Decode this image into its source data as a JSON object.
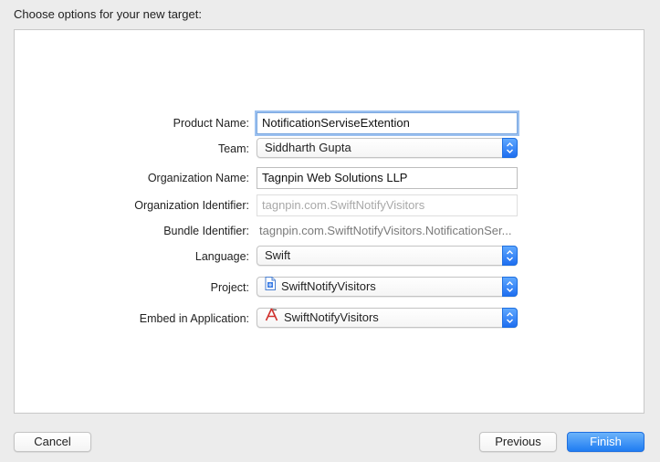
{
  "heading": "Choose options for your new target:",
  "form": {
    "product_name": {
      "label": "Product Name:",
      "value": "NotificationServiseExtention"
    },
    "team": {
      "label": "Team:",
      "value": "Siddharth Gupta"
    },
    "organization_name": {
      "label": "Organization Name:",
      "value": "Tagnpin Web Solutions LLP"
    },
    "organization_identifier": {
      "label": "Organization Identifier:",
      "value": "tagnpin.com.SwiftNotifyVisitors"
    },
    "bundle_identifier": {
      "label": "Bundle Identifier:",
      "value": "tagnpin.com.SwiftNotifyVisitors.NotificationSer..."
    },
    "language": {
      "label": "Language:",
      "value": "Swift"
    },
    "project": {
      "label": "Project:",
      "value": "SwiftNotifyVisitors",
      "icon": "project-file-icon"
    },
    "embed_in_application": {
      "label": "Embed in Application:",
      "value": "SwiftNotifyVisitors",
      "icon": "app-target-icon"
    }
  },
  "buttons": {
    "cancel": "Cancel",
    "previous": "Previous",
    "finish": "Finish"
  },
  "colors": {
    "accent": "#1f7cf2",
    "focus_ring": "#9cc1f0"
  }
}
